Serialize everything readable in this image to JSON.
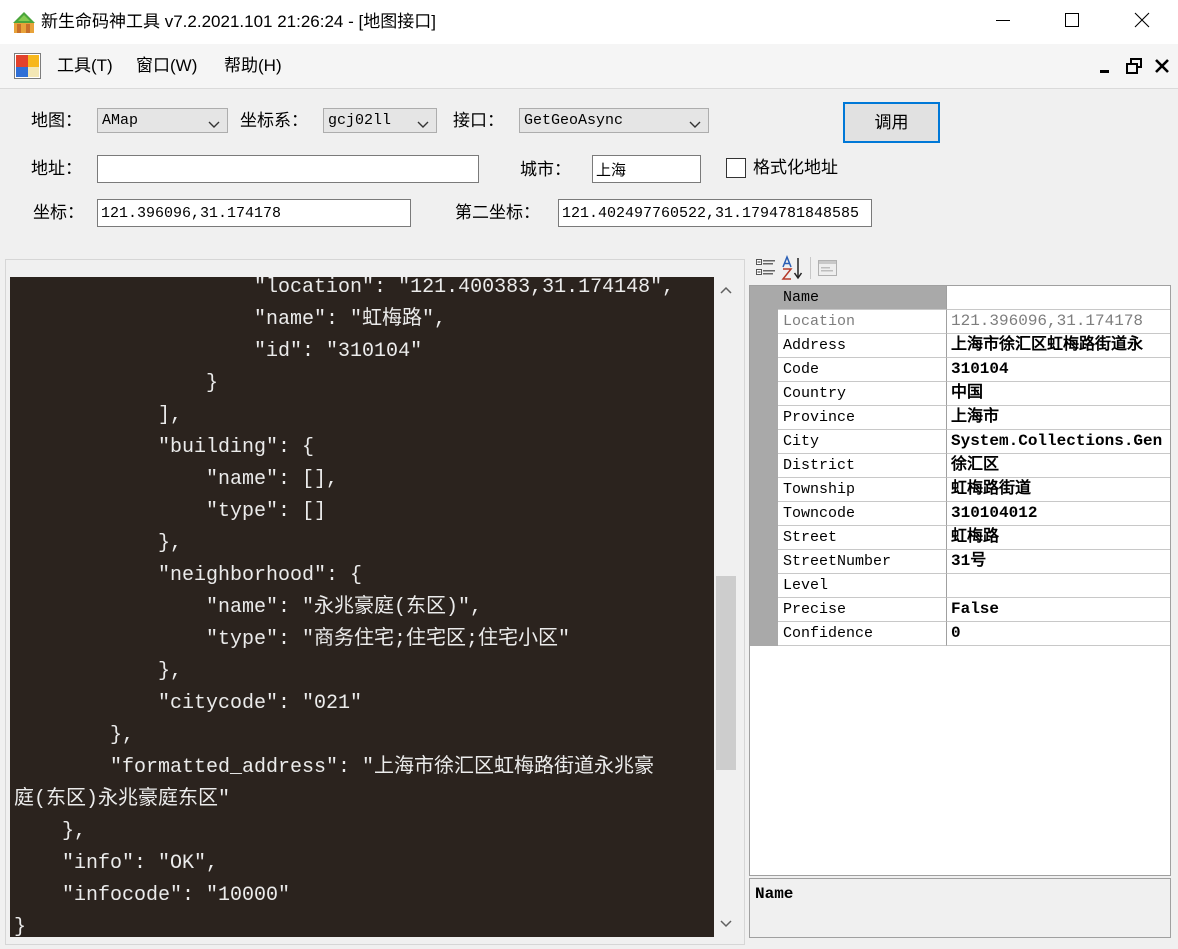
{
  "window": {
    "title": "新生命码神工具 v7.2.2021.101 21:26:24 - [地图接口]",
    "icons": {
      "app": "app-logo-icon",
      "minimize": "minimize-icon",
      "maximize": "maximize-icon",
      "close": "close-icon"
    }
  },
  "menu": {
    "icon": "mdi-form-icon",
    "items": [
      "工具(T)",
      "窗口(W)",
      "帮助(H)"
    ],
    "mdi_icons": [
      "mdi-minimize-icon",
      "mdi-restore-icon",
      "mdi-close-icon"
    ]
  },
  "form": {
    "map": {
      "label": "地图：",
      "value": "AMap"
    },
    "coord_system": {
      "label": "坐标系：",
      "value": "gcj02ll"
    },
    "api": {
      "label": "接口：",
      "value": "GetGeoAsync"
    },
    "call_button": "调用",
    "address": {
      "label": "地址：",
      "value": ""
    },
    "city": {
      "label": "城市：",
      "value": "上海"
    },
    "format_address": {
      "label": "格式化地址",
      "checked": false
    },
    "coordinate": {
      "label": "坐标：",
      "value": "121.396096,31.174178"
    },
    "second_coordinate": {
      "label": "第二坐标：",
      "value": "121.402497760522,31.1794781848585"
    }
  },
  "output": {
    "lines": [
      "                    \"location\": \"121.400383,31.174148\",",
      "                    \"name\": \"虹梅路\",",
      "                    \"id\": \"310104\"",
      "                }",
      "            ],",
      "            \"building\": {",
      "                \"name\": [],",
      "                \"type\": []",
      "            },",
      "            \"neighborhood\": {",
      "                \"name\": \"永兆豪庭(东区)\",",
      "                \"type\": \"商务住宅;住宅区;住宅小区\"",
      "            },",
      "            \"citycode\": \"021\"",
      "        },",
      "        \"formatted_address\": \"上海市徐汇区虹梅路街道永兆豪",
      "庭(东区)永兆豪庭东区\"",
      "    },",
      "    \"info\": \"OK\",",
      "    \"infocode\": \"10000\"",
      "}"
    ],
    "scroll": {
      "position": 0.66,
      "visible_fraction": 0.32
    },
    "scroll_icons": [
      "scroll-up-icon",
      "scroll-down-icon"
    ]
  },
  "property_grid": {
    "toolbar": [
      {
        "icon": "categorized-view-icon",
        "enabled": true
      },
      {
        "icon": "alphabetical-sort-icon",
        "enabled": true
      },
      {
        "icon": "property-pages-icon",
        "enabled": false
      }
    ],
    "rows": [
      {
        "name": "Name",
        "value": "",
        "selected": true
      },
      {
        "name": "Location",
        "value": "121.396096,31.174178",
        "readonly": true
      },
      {
        "name": "Address",
        "value": "上海市徐汇区虹梅路街道永"
      },
      {
        "name": "Code",
        "value": "310104"
      },
      {
        "name": "Country",
        "value": "中国"
      },
      {
        "name": "Province",
        "value": "上海市"
      },
      {
        "name": "City",
        "value": "System.Collections.Gen"
      },
      {
        "name": "District",
        "value": "徐汇区"
      },
      {
        "name": "Township",
        "value": "虹梅路街道"
      },
      {
        "name": "Towncode",
        "value": "310104012"
      },
      {
        "name": "Street",
        "value": "虹梅路"
      },
      {
        "name": "StreetNumber",
        "value": "31号"
      },
      {
        "name": "Level",
        "value": ""
      },
      {
        "name": "Precise",
        "value": "False"
      },
      {
        "name": "Confidence",
        "value": "0"
      }
    ],
    "description": {
      "title": "Name"
    }
  },
  "colors": {
    "output_background": "#2b231e",
    "output_text": "#ebebeb",
    "default_button_border": "#0078d7",
    "grid_margin": "#a9a9a9",
    "readonly_text": "#7d7d7d"
  }
}
